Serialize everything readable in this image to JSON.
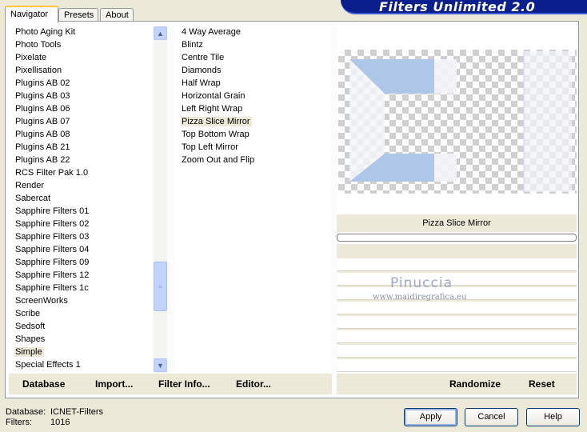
{
  "tabs": [
    {
      "label": "Navigator",
      "active": true
    },
    {
      "label": "Presets",
      "active": false
    },
    {
      "label": "About",
      "active": false
    }
  ],
  "banner": {
    "title": "Filters Unlimited 2.0"
  },
  "categories": [
    "Photo Aging Kit",
    "Photo Tools",
    "Pixelate",
    "Pixellisation",
    "Plugins AB 02",
    "Plugins AB 03",
    "Plugins AB 06",
    "Plugins AB 07",
    "Plugins AB 08",
    "Plugins AB 21",
    "Plugins AB 22",
    "RCS Filter Pak 1.0",
    "Render",
    "Sabercat",
    "Sapphire Filters 01",
    "Sapphire Filters 02",
    "Sapphire Filters 03",
    "Sapphire Filters 04",
    "Sapphire Filters 09",
    "Sapphire Filters 12",
    "Sapphire Filters 1c",
    "ScreenWorks",
    "Scribe",
    "Sedsoft",
    "Shapes",
    "Simple",
    "Special Effects 1"
  ],
  "selected_category": "Simple",
  "filters": [
    "4 Way Average",
    "Blintz",
    "Centre Tile",
    "Diamonds",
    "Half Wrap",
    "Horizontal Grain",
    "Left Right Wrap",
    "Pizza Slice Mirror",
    "Top Bottom Wrap",
    "Top Left Mirror",
    "Zoom Out and Flip"
  ],
  "selected_filter": "Pizza Slice Mirror",
  "list_footer": {
    "database": "Database",
    "import": "Import...",
    "filter_info": "Filter Info...",
    "editor": "Editor..."
  },
  "preview": {
    "filter_name": "Pizza Slice Mirror"
  },
  "watermark": {
    "name": "Pinuccia",
    "site": "www.maidiregrafica.eu"
  },
  "right_footer": {
    "randomize": "Randomize",
    "reset": "Reset"
  },
  "status": {
    "database_label": "Database:",
    "database_value": "ICNET-Filters",
    "filters_label": "Filters:",
    "filters_value": "1016"
  },
  "buttons": {
    "apply": "Apply",
    "cancel": "Cancel",
    "help": "Help"
  },
  "colors": {
    "banner": "#0a1e8c",
    "accent_blue": "#aec6e8",
    "dialog_bg": "#ece9d8"
  }
}
